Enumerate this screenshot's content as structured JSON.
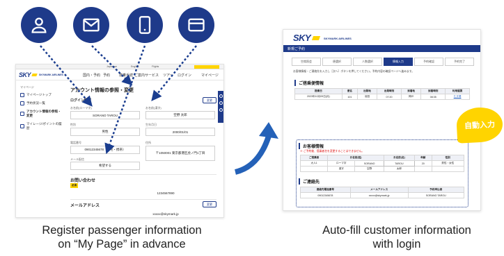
{
  "captions": {
    "left_line1": "Register passenger information",
    "left_line2": "on “My Page” in advance",
    "right_line1": "Auto-fill customer information",
    "right_line2": "with login"
  },
  "icons": [
    "person-icon",
    "mail-icon",
    "smartphone-icon",
    "credit-card-icon"
  ],
  "colors": {
    "navy": "#1e3a8a",
    "yellow": "#ffd400",
    "arrow": "#1a3d8f",
    "red": "#dd1111"
  },
  "left": {
    "brand": "SKY",
    "brand_sub": "SKYMARK AIRLINES",
    "top_links": [
      "Japanese",
      "English",
      "Flights"
    ],
    "nav": [
      "国内・予約",
      "予約",
      "搭乗手続",
      "ご案内サービス",
      "ツアー",
      "ログイン",
      "マイページ"
    ],
    "page_title": "アカウント情報の参照・変更",
    "side_label": "マイページ",
    "side_items": [
      "マイページトップ",
      "予約状況一覧",
      "アカウント情報の参照・変更",
      "マイレージ/ポイントの履歴"
    ],
    "section_label": "ログイン情報",
    "edit_label": "変更",
    "name_roman_label": "お名前(ローマ字)",
    "name_roman_value": "SORANO TAROU",
    "name_kanji_label": "お名前(漢字)",
    "name_kanji_value": "空野 太郎",
    "gender_label": "性別",
    "gender_value": "男性",
    "birth_label": "生年月日",
    "birth_value": "2000/01/01",
    "phone_label": "電話番号",
    "phone_value": "09012345678（自宅・携帯）",
    "address_label": "住所",
    "address_value": "〒1050001 東京都港区虎ノ門1丁目",
    "mail_opt_label": "メール配信",
    "mail_opt_value": "希望する",
    "contact_title": "お問い合わせ",
    "contact_tag": "必須",
    "contact_value": "1234567890",
    "email_title": "メールアドレス",
    "email_value": "xxxxx@skymark.jp"
  },
  "right": {
    "brand": "SKY",
    "brand_sub": "SKYMARK AIRLINES",
    "banner": "新規ご予約",
    "steps": [
      "空席照会",
      "便選択",
      "人数選択",
      "情報入力",
      "予約確認",
      "予約完了"
    ],
    "active_step": 3,
    "intro": "お客様情報・ご連絡先を入力し［次へ］ボタンを押してください。予約内容の確認ページへ進みます。",
    "flight_section": "ご搭乗便情報",
    "flight_headers": [
      "搭乗日",
      "便名",
      "出発地",
      "出発時刻",
      "到着地",
      "到着時刻",
      "利用運賃"
    ],
    "flight_row": [
      "2023年10月09日(月)",
      "101",
      "羽田",
      "07:20",
      "神戸",
      "08:35",
      "たす得"
    ],
    "customer_section": "お客様情報",
    "red_note": "※ ご予約後、搭乗者名を変更することはできません。",
    "cust_headers": [
      "ご搭乗者",
      "お名前(姓)",
      "お名前(名)",
      "年齢",
      "性別"
    ],
    "cust_tag": "必須",
    "cust_row1": [
      "大人1",
      "ローマ字",
      "SORANO",
      "TAROU",
      "20",
      "男性・女性"
    ],
    "cust_row2": [
      "",
      "漢字",
      "空野",
      "太郎",
      "",
      ""
    ],
    "contact_section": "ご連絡先",
    "contact_headers": [
      "連絡先電話番号",
      "メールアドレス",
      "予約申込者"
    ],
    "contact_row": [
      "09012345678",
      "xxxxx@skymark.jp",
      "SORANO TAROU"
    ],
    "auto_badge": "自動入力"
  }
}
